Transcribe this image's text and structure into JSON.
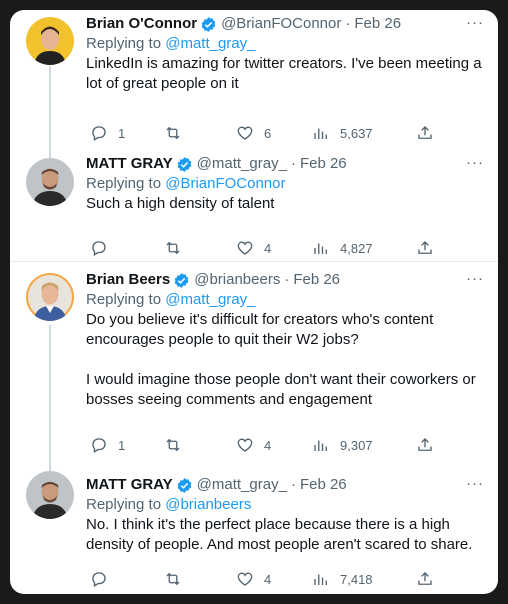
{
  "replying_prefix": "Replying to",
  "more_label": "···",
  "tweets": [
    {
      "name": "Brian O'Connor",
      "handle": "@BrianFOConnor",
      "separator": "·",
      "date": "Feb 26",
      "replying_to": "@matt_gray_",
      "text": "LinkedIn is amazing for twitter creators. I've been meeting a lot of great people on it",
      "replies": "1",
      "retweets": "",
      "likes": "6",
      "views": "5,637"
    },
    {
      "name": "MATT GRAY",
      "handle": "@matt_gray_",
      "separator": "·",
      "date": "Feb 26",
      "replying_to": "@BrianFOConnor",
      "text": "Such a high density of talent",
      "replies": "",
      "retweets": "",
      "likes": "4",
      "views": "4,827"
    },
    {
      "name": "Brian Beers",
      "handle": "@brianbeers",
      "separator": "·",
      "date": "Feb 26",
      "replying_to": "@matt_gray_",
      "text": "Do you believe it's difficult for creators who's content encourages people to quit their W2 jobs?\n\nI would imagine those people don't want their coworkers or bosses seeing comments and engagement",
      "replies": "1",
      "retweets": "",
      "likes": "4",
      "views": "9,307"
    },
    {
      "name": "MATT GRAY",
      "handle": "@matt_gray_",
      "separator": "·",
      "date": "Feb 26",
      "replying_to": "@brianbeers",
      "text": "No. I think it's the perfect place because there is a high density of people. And most people aren't scared to share.",
      "replies": "",
      "retweets": "",
      "likes": "4",
      "views": "7,418"
    }
  ],
  "colors": {
    "link": "#1d9bf0",
    "secondary_text": "#536471",
    "verified": "#1d9bf0",
    "thread_line": "#cfd9de"
  },
  "icons": {
    "reply": "reply-icon",
    "retweet": "retweet-icon",
    "like": "heart-icon",
    "views": "views-chart-icon",
    "share": "share-icon",
    "verified": "verified-badge-icon",
    "more": "more-icon"
  }
}
